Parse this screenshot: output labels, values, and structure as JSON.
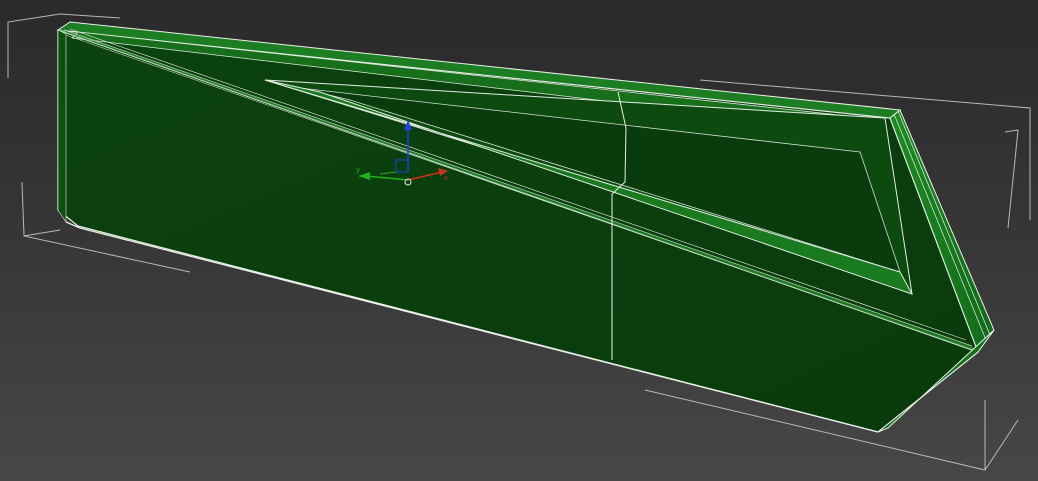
{
  "viewport": {
    "background_top": "#2a2a2a",
    "background_bottom": "#474747"
  },
  "object": {
    "fill_front": "#0a3d0d",
    "fill_bevel": "#1a7a1f",
    "fill_bevel_light": "#2a9a30",
    "wire_color": "#e8f0e8"
  },
  "selection_bracket": {
    "color": "#b8b8b8"
  },
  "gizmo": {
    "x_axis_color": "#d03020",
    "y_axis_color": "#20b020",
    "z_axis_color": "#2040e0",
    "pivot_color": "#e0e0e0",
    "x_label": "x",
    "y_label": "y"
  }
}
